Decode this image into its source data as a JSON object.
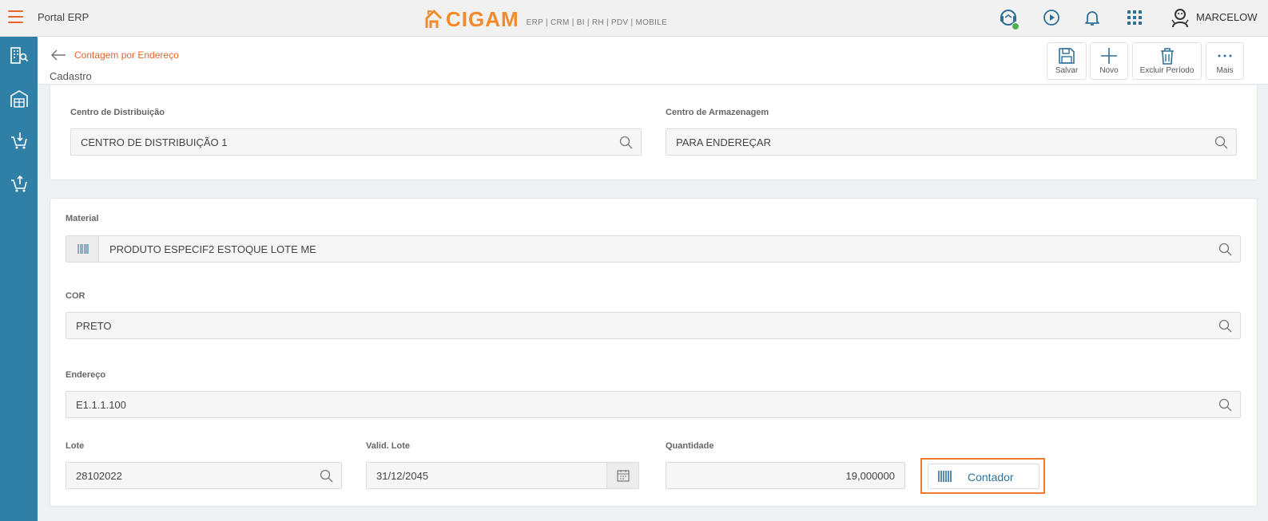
{
  "header": {
    "app_title": "Portal ERP",
    "logo_text": "CIGAM",
    "logo_subtitle": "ERP | CRM | BI | RH | PDV | MOBILE",
    "username": "MARCELOW",
    "accent_color": "#e8652b",
    "brand_color": "#f38a2a",
    "icons": [
      "menu-icon",
      "support-icon",
      "play-circle-icon",
      "bell-icon",
      "apps-grid-icon",
      "user-avatar-icon"
    ]
  },
  "sidebar": {
    "color": "#2f7fa6",
    "icons": [
      "person-search-icon",
      "warehouse-icon",
      "cart-download-icon",
      "cart-upload-icon"
    ]
  },
  "page": {
    "breadcrumb": "Contagem por Endereço",
    "subtitle": "Cadastro",
    "actions": {
      "save": "Salvar",
      "new": "Novo",
      "delete_period": "Excluir Período",
      "more": "Mais"
    }
  },
  "form": {
    "centro_distribuicao": {
      "label": "Centro de Distribuição",
      "value": "CENTRO DE DISTRIBUIÇÃO 1"
    },
    "centro_armazenagem": {
      "label": "Centro de Armazenagem",
      "value": "PARA ENDEREÇAR"
    },
    "material": {
      "label": "Material",
      "value": "PRODUTO ESPECIF2 ESTOQUE LOTE ME"
    },
    "cor": {
      "label": "COR",
      "value": "PRETO"
    },
    "endereco": {
      "label": "Endereço",
      "value": "E1.1.1.100"
    },
    "lote": {
      "label": "Lote",
      "value": "28102022"
    },
    "valid_lote": {
      "label": "Valid. Lote",
      "value": "31/12/2045"
    },
    "quantidade": {
      "label": "Quantidade",
      "value": "19,000000"
    },
    "contador_button": "Contador"
  }
}
